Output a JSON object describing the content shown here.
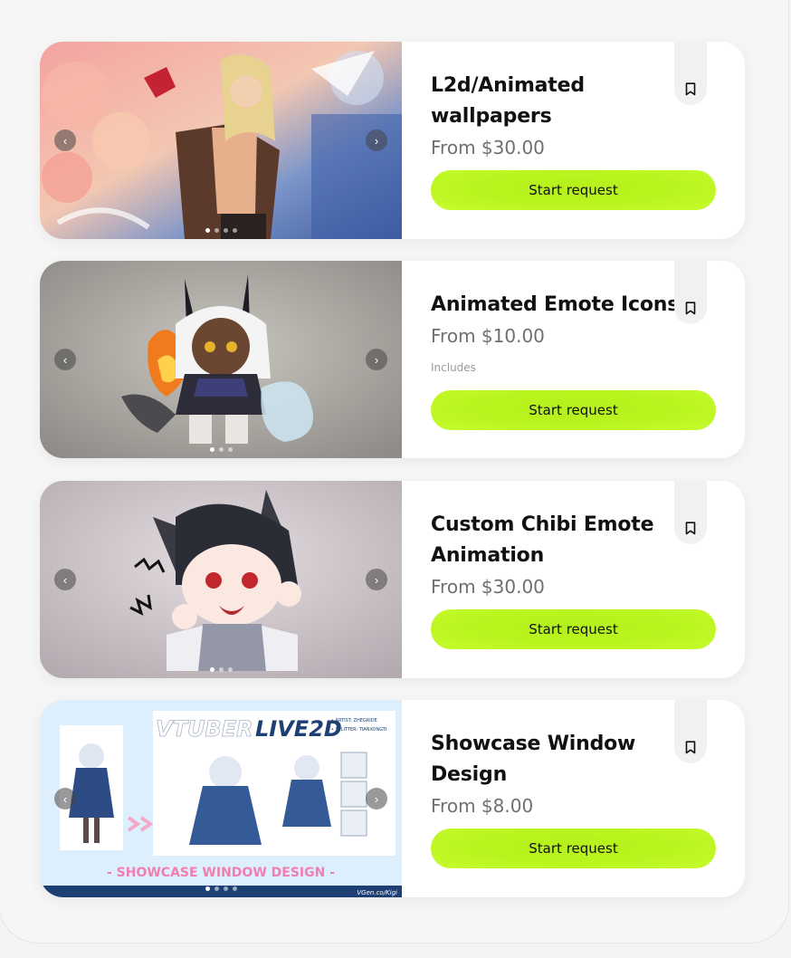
{
  "cards": [
    {
      "title": "L2d/Animated wallpapers",
      "price": "From $30.00",
      "includes": "",
      "cta": "Start request",
      "slide_count": 4,
      "active_slide": 0
    },
    {
      "title": "Animated Emote Icons",
      "price": "From $10.00",
      "includes": "Includes",
      "cta": "Start request",
      "slide_count": 3,
      "active_slide": 0
    },
    {
      "title": "Custom Chibi Emote Animation",
      "price": "From $30.00",
      "includes": "",
      "cta": "Start request",
      "slide_count": 3,
      "active_slide": 0
    },
    {
      "title": "Showcase Window Design",
      "price": "From $8.00",
      "includes": "",
      "cta": "Start request",
      "slide_count": 4,
      "active_slide": 0
    }
  ],
  "showcase_image": {
    "heading_left": "VTUBER",
    "heading_right": "LIVE2D",
    "artist_line": "• ARTIST: ZHEGRIDE",
    "splitter_line": "• SPLITTER: TIANXONGTI",
    "banner": "- SHOWCASE WINDOW DESIGN -",
    "credit": "VGen.co/Kigi"
  },
  "icons": {
    "prev": "chevron-left-icon",
    "next": "chevron-right-icon",
    "bookmark": "bookmark-icon"
  },
  "colors": {
    "cta": "#bbf520",
    "price": "#6f6f6f",
    "title": "#111111"
  }
}
